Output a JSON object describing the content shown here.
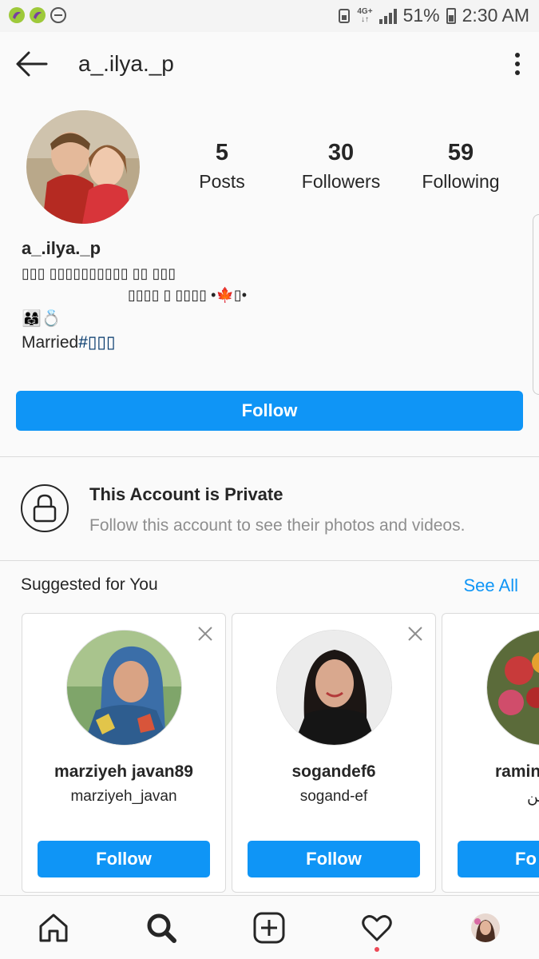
{
  "status_bar": {
    "network": "4G+",
    "battery": "51%",
    "time": "2:30 AM"
  },
  "header": {
    "title": "a_.ilya._p"
  },
  "profile": {
    "stats": [
      {
        "value": "5",
        "label": "Posts"
      },
      {
        "value": "30",
        "label": "Followers"
      },
      {
        "value": "59",
        "label": "Following"
      }
    ],
    "name": "a_.ilya._p",
    "bio_line1": "▯▯▯ ▯▯▯▯▯▯▯▯▯▯ ▯▯ ▯▯▯",
    "bio_line2": "▯▯▯▯ ▯ ▯▯▯▯ •🍁▯•",
    "bio_emoji": "👨‍👩‍👧💍",
    "bio_married": "Married",
    "bio_hashtag": "#▯▯▯",
    "follow_label": "Follow"
  },
  "private": {
    "title": "This Account is Private",
    "subtitle": "Follow this account to see their photos and videos."
  },
  "suggested": {
    "title": "Suggested for You",
    "see_all": "See All",
    "cards": [
      {
        "username": "marziyeh javan89",
        "name": "marziyeh_javan",
        "follow": "Follow"
      },
      {
        "username": "sogandef6",
        "name": "sogand-ef",
        "follow": "Follow"
      },
      {
        "username": "ramin",
        "name": "ین",
        "follow": "Fo"
      }
    ]
  },
  "colors": {
    "accent": "#0f95f6",
    "text": "#262626",
    "secondary": "#8e8e8e",
    "notification": "#ed4956"
  },
  "icons": {
    "back": "arrow-left-icon",
    "menu": "more-vertical-icon",
    "lock": "lock-icon",
    "close": "close-icon",
    "home": "home-icon",
    "search": "search-icon",
    "add": "add-post-icon",
    "activity": "heart-icon"
  }
}
